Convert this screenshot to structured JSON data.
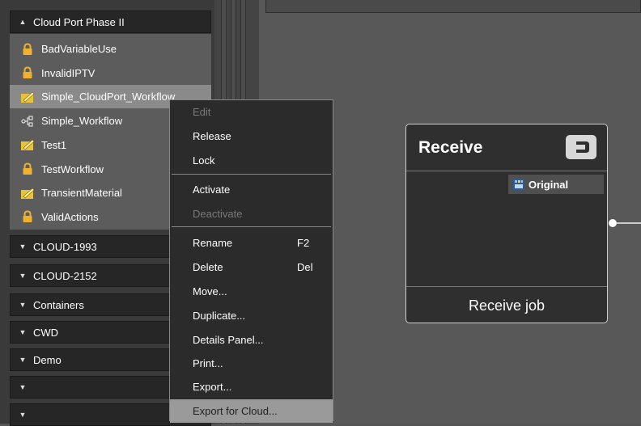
{
  "left_panel": {
    "expanded_group": {
      "label": "Cloud Port Phase II",
      "items": [
        {
          "label": "BadVariableUse",
          "icon": "lock-icon"
        },
        {
          "label": "InvalidIPTV",
          "icon": "lock-icon"
        },
        {
          "label": "Simple_CloudPort_Workflow",
          "icon": "edit-icon",
          "selected": true
        },
        {
          "label": "Simple_Workflow",
          "icon": "workflow-icon"
        },
        {
          "label": "Test1",
          "icon": "edit-icon"
        },
        {
          "label": "TestWorkflow",
          "icon": "lock-icon"
        },
        {
          "label": "TransientMaterial",
          "icon": "edit-icon"
        },
        {
          "label": "ValidActions",
          "icon": "lock-icon"
        }
      ]
    },
    "collapsed_groups": [
      {
        "label": "CLOUD-1993"
      },
      {
        "label": "CLOUD-2152"
      },
      {
        "label": "Containers"
      },
      {
        "label": "CWD"
      },
      {
        "label": "Demo"
      },
      {
        "label": ""
      },
      {
        "label": ""
      }
    ]
  },
  "context_menu": {
    "items": [
      {
        "label": "Edit",
        "disabled": true
      },
      {
        "label": "Release"
      },
      {
        "label": "Lock"
      },
      {
        "label": "Activate"
      },
      {
        "label": "Deactivate",
        "disabled": true
      },
      {
        "label": "Rename",
        "shortcut": "F2"
      },
      {
        "label": "Delete",
        "shortcut": "Del"
      },
      {
        "label": "Move..."
      },
      {
        "label": "Duplicate..."
      },
      {
        "label": "Details Panel..."
      },
      {
        "label": "Print..."
      },
      {
        "label": "Export..."
      },
      {
        "label": "Export for Cloud...",
        "highlighted": true
      }
    ]
  },
  "node": {
    "title": "Receive",
    "port_label": "Original",
    "footer": "Receive job",
    "icon": "receive-icon"
  },
  "colors": {
    "menu_bg": "#2b2b2b",
    "highlight": "#9a9a9a",
    "lock": "#f0b030",
    "edit": "#e8c23a"
  }
}
